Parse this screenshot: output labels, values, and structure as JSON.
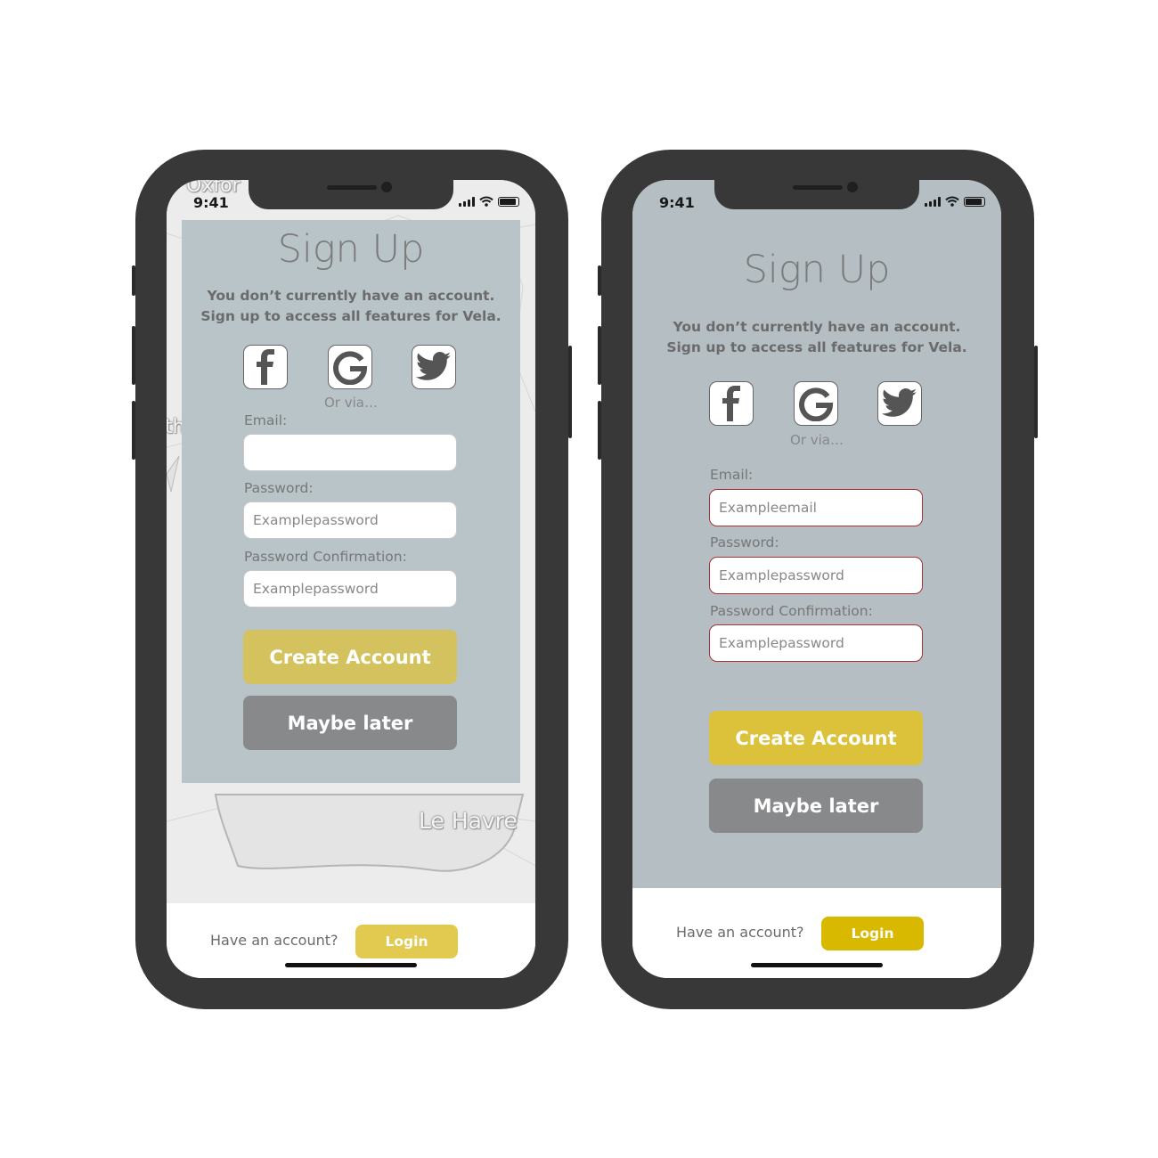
{
  "status": {
    "time": "9:41"
  },
  "map": {
    "label_top": "Oxfor",
    "label_le_havre": "Le Havre",
    "label_left": "th"
  },
  "screens": [
    {
      "variant": "map-background",
      "title": "Sign Up",
      "subtitle_line1": "You don’t currently have an account.",
      "subtitle_line2": "Sign up to access all features for Vela.",
      "or_via": "Or via…",
      "email_label": "Email:",
      "email_value": "",
      "password_label": "Password:",
      "password_value": "Examplepassword",
      "confirm_label": "Password Confirmation:",
      "confirm_value": "Examplepassword",
      "create_label": "Create Account",
      "later_label": "Maybe later",
      "have_account": "Have an account?",
      "login_label": "Login"
    },
    {
      "variant": "full-panel",
      "title": "Sign Up",
      "subtitle_line1": "You don’t currently have an account.",
      "subtitle_line2": "Sign up to access all features for Vela.",
      "or_via": "Or via…",
      "email_label": "Email:",
      "email_value": "Exampleemail",
      "password_label": "Password:",
      "password_value": "Examplepassword",
      "confirm_label": "Password Confirmation:",
      "confirm_value": "Examplepassword",
      "create_label": "Create Account",
      "later_label": "Maybe later",
      "have_account": "Have an account?",
      "login_label": "Login"
    }
  ],
  "icons": [
    "facebook-icon",
    "google-icon",
    "twitter-icon"
  ],
  "colors": {
    "panel": "#b9c4c9",
    "create_button": "#d3c25e",
    "create_button_alt": "#dbc23a",
    "later_button": "#87898b",
    "login_button": "#e2c94f",
    "login_button_alt": "#d9b800",
    "error_border": "#a8323a",
    "phone_frame": "#383838"
  }
}
